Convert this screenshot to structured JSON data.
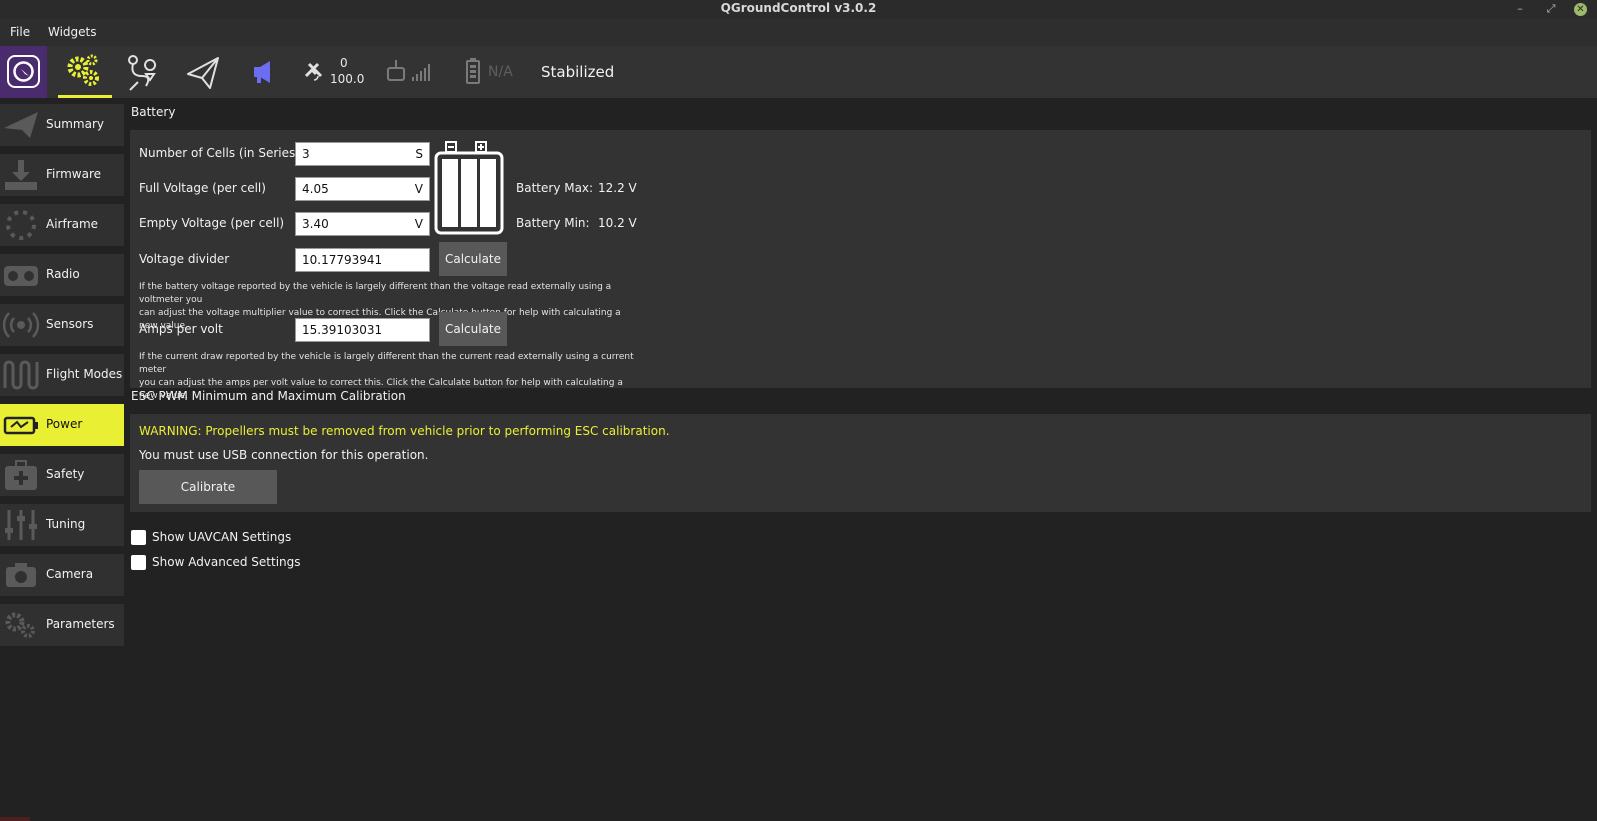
{
  "window": {
    "title": "QGroundControl v3.0.2",
    "min": "–",
    "max": "⤢",
    "close": "✕"
  },
  "menu": {
    "file": "File",
    "widgets": "Widgets"
  },
  "toolbar": {
    "gps_count": "0",
    "gps_hdop": "100.0",
    "battery": "N/A",
    "flight_mode": "Stabilized"
  },
  "sidebar": {
    "items": [
      {
        "label": "Summary",
        "icon": "paper-plane-icon"
      },
      {
        "label": "Firmware",
        "icon": "download-icon"
      },
      {
        "label": "Airframe",
        "icon": "airframe-icon"
      },
      {
        "label": "Radio",
        "icon": "radio-icon"
      },
      {
        "label": "Sensors",
        "icon": "sensors-icon"
      },
      {
        "label": "Flight Modes",
        "icon": "flight-modes-icon"
      },
      {
        "label": "Power",
        "icon": "battery-icon"
      },
      {
        "label": "Safety",
        "icon": "first-aid-icon"
      },
      {
        "label": "Tuning",
        "icon": "sliders-icon"
      },
      {
        "label": "Camera",
        "icon": "camera-icon"
      },
      {
        "label": "Parameters",
        "icon": "gears-icon"
      }
    ]
  },
  "battery": {
    "title": "Battery",
    "cells_label": "Number of Cells (in Series)",
    "cells_value": "3",
    "cells_unit": "S",
    "full_label": "Full Voltage (per cell)",
    "full_value": "4.05",
    "full_unit": "V",
    "empty_label": "Empty Voltage (per cell)",
    "empty_value": "3.40",
    "empty_unit": "V",
    "divider_label": "Voltage divider",
    "divider_value": "10.17793941",
    "amps_label": "Amps per volt",
    "amps_value": "15.39103031",
    "calculate": "Calculate",
    "max_label": "Battery Max:",
    "max_value": "12.2 V",
    "min_label": "Battery Min:",
    "min_value": "10.2 V",
    "divider_help_1": "If the battery voltage reported by the vehicle is largely different than the voltage read externally using a voltmeter you",
    "divider_help_2": "can adjust the voltage multiplier value to correct this. Click the Calculate button for help with calculating a new value.",
    "amps_help_1": "If the current draw reported by the vehicle is largely different than the current read externally using a current meter",
    "amps_help_2": "you can adjust the amps per volt value to correct this. Click the Calculate button for help with calculating a new value."
  },
  "esc": {
    "title": "ESC PWM Minimum and Maximum Calibration",
    "warning": "WARNING: Propellers must be removed from vehicle prior to performing ESC calibration.",
    "usb_note": "You must use USB connection for this operation.",
    "calibrate": "Calibrate"
  },
  "options": {
    "uavcan": "Show UAVCAN Settings",
    "advanced": "Show Advanced Settings"
  },
  "colors": {
    "accent": "#e9f034",
    "logo_bg": "#4a2b6d",
    "panel": "#333333",
    "background": "#222222"
  }
}
